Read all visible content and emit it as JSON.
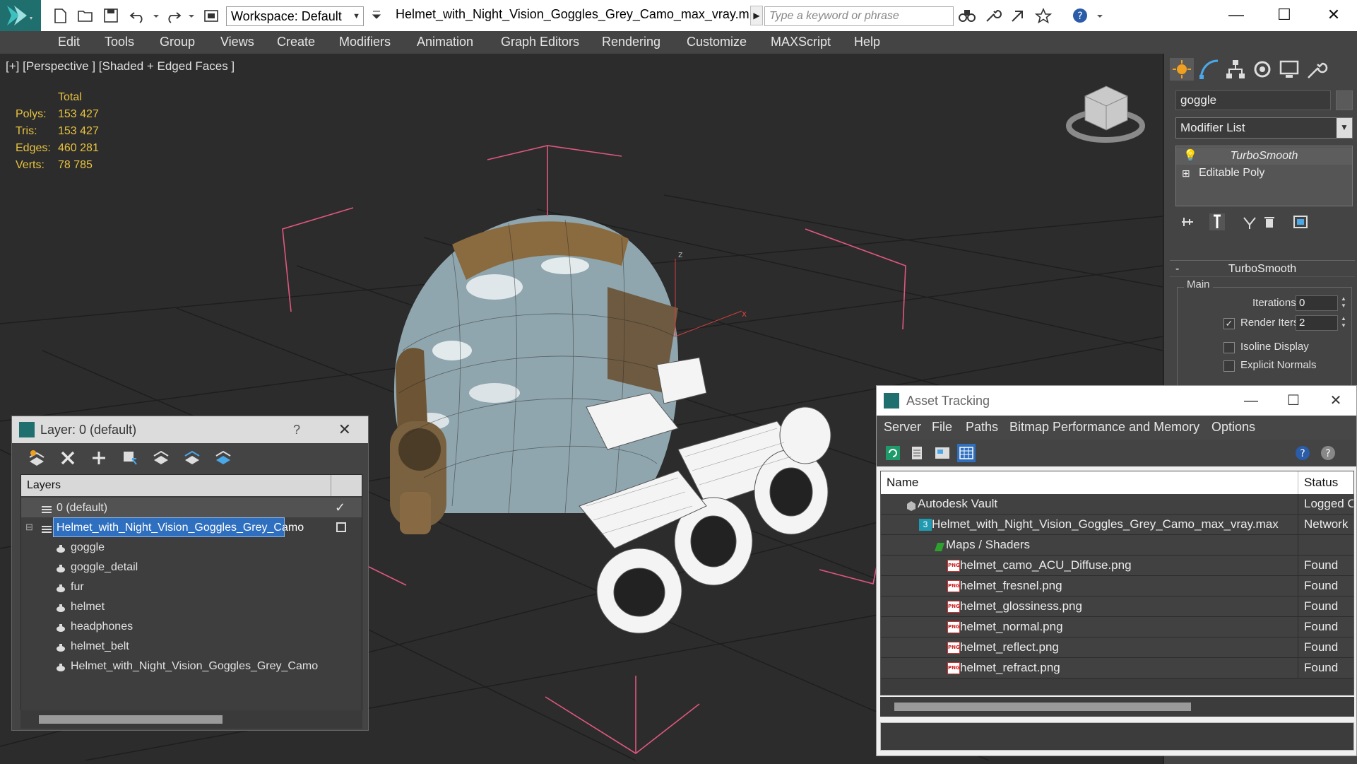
{
  "titlebar": {
    "workspace": "Workspace: Default",
    "file_title": "Helmet_with_Night_Vision_Goggles_Grey_Camo_max_vray.m...",
    "search_placeholder": "Type a keyword or phrase",
    "minimize": "—",
    "maximize": "☐",
    "close": "✕"
  },
  "menu": [
    "Edit",
    "Tools",
    "Group",
    "Views",
    "Create",
    "Modifiers",
    "Animation",
    "Graph Editors",
    "Rendering",
    "Customize",
    "MAXScript",
    "Help"
  ],
  "viewport": {
    "label": "[+] [Perspective ] [Shaded + Edged Faces ]",
    "stats": {
      "header": "Total",
      "polys_label": "Polys:",
      "polys": "153 427",
      "tris_label": "Tris:",
      "tris": "153 427",
      "edges_label": "Edges:",
      "edges": "460 281",
      "verts_label": "Verts:",
      "verts": "78 785"
    },
    "axis_z": "z",
    "axis_x": "x"
  },
  "command_panel": {
    "object_name": "goggle",
    "modifier_list": "Modifier List",
    "stack": [
      "TurboSmooth",
      "Editable Poly"
    ],
    "rollout_title": "TurboSmooth",
    "rollout_minus": "-",
    "group": "Main",
    "iterations_label": "Iterations:",
    "iterations": "0",
    "render_iters_label": "Render Iters:",
    "render_iters": "2",
    "isoline_label": "Isoline Display",
    "explicit_label": "Explicit Normals"
  },
  "layer_window": {
    "title": "Layer: 0 (default)",
    "help": "?",
    "close": "✕",
    "header": "Layers",
    "rows": [
      {
        "label": "0 (default)"
      },
      {
        "label": "Helmet_with_Night_Vision_Goggles_Grey_Camo"
      },
      {
        "label": "goggle"
      },
      {
        "label": "goggle_detail"
      },
      {
        "label": "fur"
      },
      {
        "label": "helmet"
      },
      {
        "label": "headphones"
      },
      {
        "label": "helmet_belt"
      },
      {
        "label": "Helmet_with_Night_Vision_Goggles_Grey_Camo"
      }
    ],
    "check": "✓"
  },
  "asset_tracking": {
    "title": "Asset Tracking",
    "menu": [
      "Server",
      "File",
      "Paths",
      "Bitmap Performance and Memory",
      "Options"
    ],
    "col_name": "Name",
    "col_status": "Status",
    "rows": [
      {
        "name": "Autodesk Vault",
        "status": "Logged Out"
      },
      {
        "name": "Helmet_with_Night_Vision_Goggles_Grey_Camo_max_vray.max",
        "status": "Network"
      },
      {
        "name": "Maps / Shaders",
        "status": ""
      },
      {
        "name": "helmet_camo_ACU_Diffuse.png",
        "status": "Found"
      },
      {
        "name": "helmet_fresnel.png",
        "status": "Found"
      },
      {
        "name": "helmet_glossiness.png",
        "status": "Found"
      },
      {
        "name": "helmet_normal.png",
        "status": "Found"
      },
      {
        "name": "helmet_reflect.png",
        "status": "Found"
      },
      {
        "name": "helmet_refract.png",
        "status": "Found"
      }
    ],
    "png_tag": "PNG",
    "max_tag": "3",
    "minimize": "—",
    "maximize": "☐",
    "close": "✕"
  },
  "colors": {
    "accent": "#2f6fbf",
    "stats_yellow": "#e8c340",
    "bbox_pink": "#e0577f",
    "brand_teal": "#1f6f6f"
  }
}
